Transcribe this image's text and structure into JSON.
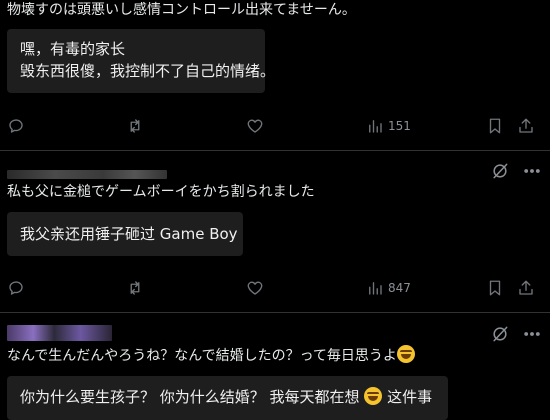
{
  "posts": [
    {
      "original_text": "物壊すのは頭悪いし感情コントロール出来てませーん。",
      "translation_lines": [
        "嘿，有毒的家长",
        "毁东西很傻，我控制不了自己的情绪。"
      ],
      "views": "151"
    },
    {
      "original_text": "私も父に金槌でゲームボーイをかち割られました",
      "translation_lines": [
        "我父亲还用锤子砸过 Game Boy"
      ],
      "views": "847"
    },
    {
      "original_text": "なんで生んだんやろうね？なんで結婚したの？って毎日思うよ",
      "translation_prefix": "你为什么要生孩子？ 你为什么结婚？ 我每天都在想",
      "translation_suffix": "这件事"
    }
  ],
  "icons": {
    "reply": "reply-icon",
    "repost": "repost-icon",
    "like": "heart-icon",
    "views": "views-chart-icon",
    "bookmark": "bookmark-icon",
    "share": "share-icon",
    "grok": "grok-icon",
    "more": "more-icon",
    "emoji": "rolling-laughing-emoji"
  },
  "colors": {
    "background": "#000000",
    "text": "#e7e9ea",
    "muted": "#71767b",
    "box": "#1e1e1e"
  }
}
